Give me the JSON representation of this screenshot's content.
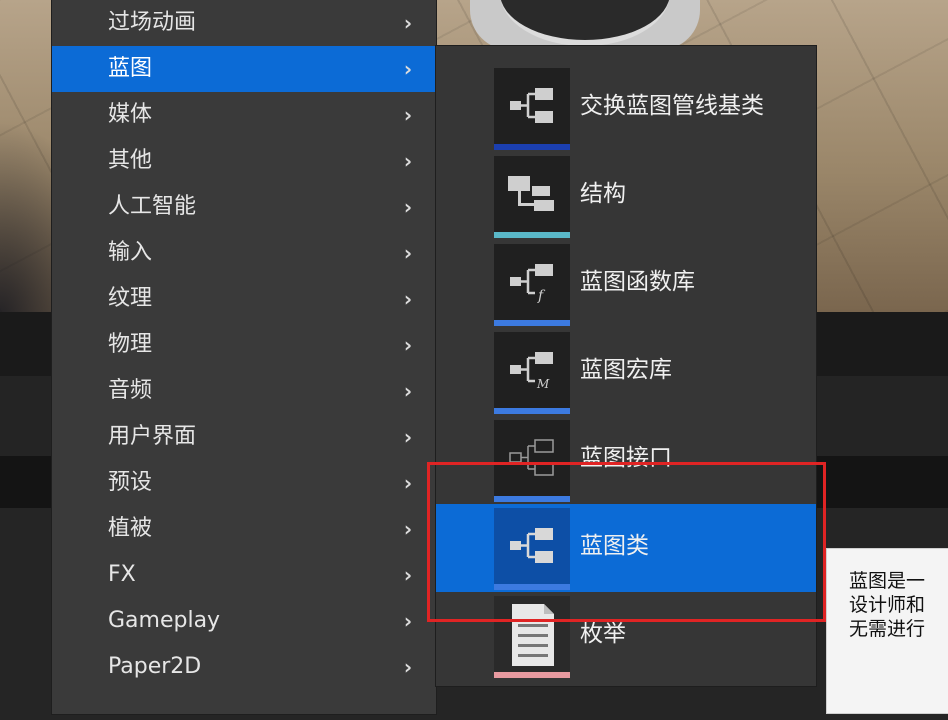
{
  "category_menu": {
    "items": [
      {
        "label": "过场动画",
        "icon": "chevron-right-icon"
      },
      {
        "label": "蓝图",
        "icon": "chevron-right-icon",
        "selected": true
      },
      {
        "label": "媒体",
        "icon": "chevron-right-icon"
      },
      {
        "label": "其他",
        "icon": "chevron-right-icon"
      },
      {
        "label": "人工智能",
        "icon": "chevron-right-icon"
      },
      {
        "label": "输入",
        "icon": "chevron-right-icon"
      },
      {
        "label": "纹理",
        "icon": "chevron-right-icon"
      },
      {
        "label": "物理",
        "icon": "chevron-right-icon"
      },
      {
        "label": "音频",
        "icon": "chevron-right-icon"
      },
      {
        "label": "用户界面",
        "icon": "chevron-right-icon"
      },
      {
        "label": "预设",
        "icon": "chevron-right-icon"
      },
      {
        "label": "植被",
        "icon": "chevron-right-icon"
      },
      {
        "label": "FX",
        "icon": "chevron-right-icon"
      },
      {
        "label": "Gameplay",
        "icon": "chevron-right-icon"
      },
      {
        "label": "Paper2D",
        "icon": "chevron-right-icon"
      }
    ],
    "chevron_glyph": "›"
  },
  "blueprint_submenu": {
    "items": [
      {
        "label": "交换蓝图管线基类",
        "icon": "blueprint-node-icon",
        "accent": "#1b3fb0"
      },
      {
        "label": "结构",
        "icon": "struct-icon",
        "accent": "#5ab8c8"
      },
      {
        "label": "蓝图函数库",
        "icon": "blueprint-function-library-icon",
        "accent": "#3c7ae0"
      },
      {
        "label": "蓝图宏库",
        "icon": "blueprint-macro-library-icon",
        "accent": "#3c7ae0"
      },
      {
        "label": "蓝图接口",
        "icon": "blueprint-interface-icon",
        "accent": "#3c7ae0"
      },
      {
        "label": "蓝图类",
        "icon": "blueprint-class-icon",
        "accent": "#3c7ae0",
        "selected": true
      },
      {
        "label": "枚举",
        "icon": "enum-icon",
        "accent": "#e89aa0"
      }
    ]
  },
  "tooltip": {
    "lines": [
      "蓝图是一",
      "设计师和",
      "无需进行"
    ]
  },
  "colors": {
    "selection": "#0c6bd6",
    "highlight_box": "#e02424",
    "menu_bg": "#3a3a3a"
  }
}
